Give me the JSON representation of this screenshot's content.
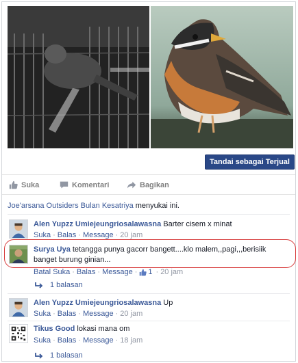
{
  "post": {
    "sold_button": "Tandai sebagai Terjual",
    "actions": {
      "like": "Suka",
      "comment": "Komentari",
      "share": "Bagikan"
    },
    "likes": {
      "who": "Joe'arsana Outsiders Bulan Kesatriya",
      "suffix": " menyukai ini."
    }
  },
  "comments": [
    {
      "name": "Alen Yupzz Umiejeungriosalawasna",
      "text": " Barter cisem x minat",
      "meta": {
        "like": "Suka",
        "reply": "Balas",
        "message": "Message",
        "time": "20 jam"
      }
    },
    {
      "name": "Surya Uya",
      "text": " tetangga punya gacorr bangett....klo malem,,pagi,,,berisiik banget burung ginian...",
      "meta": {
        "like": "Batal Suka",
        "reply": "Balas",
        "message": "Message",
        "likes_count": "1",
        "time": "20 jam"
      }
    },
    {
      "name": "Alen Yupzz Umiejeungriosalawasna",
      "text": " Up",
      "meta": {
        "like": "Suka",
        "reply": "Balas",
        "message": "Message",
        "time": "20 jam"
      }
    },
    {
      "name": "Tikus Good",
      "text": " lokasi mana om",
      "meta": {
        "like": "Suka",
        "reply": "Balas",
        "message": "Message",
        "time": "18 jam"
      }
    }
  ],
  "replies": [
    {
      "label": "1 balasan"
    },
    {
      "label": "1 balasan"
    }
  ],
  "colors": {
    "link": "#3b5998",
    "button": "#2a4887",
    "highlight": "#d73a3a",
    "meta": "#9197a3"
  },
  "icons": [
    "thumbs-up-icon",
    "comment-icon",
    "share-icon",
    "reply-arrow-icon",
    "qr-code-icon"
  ]
}
